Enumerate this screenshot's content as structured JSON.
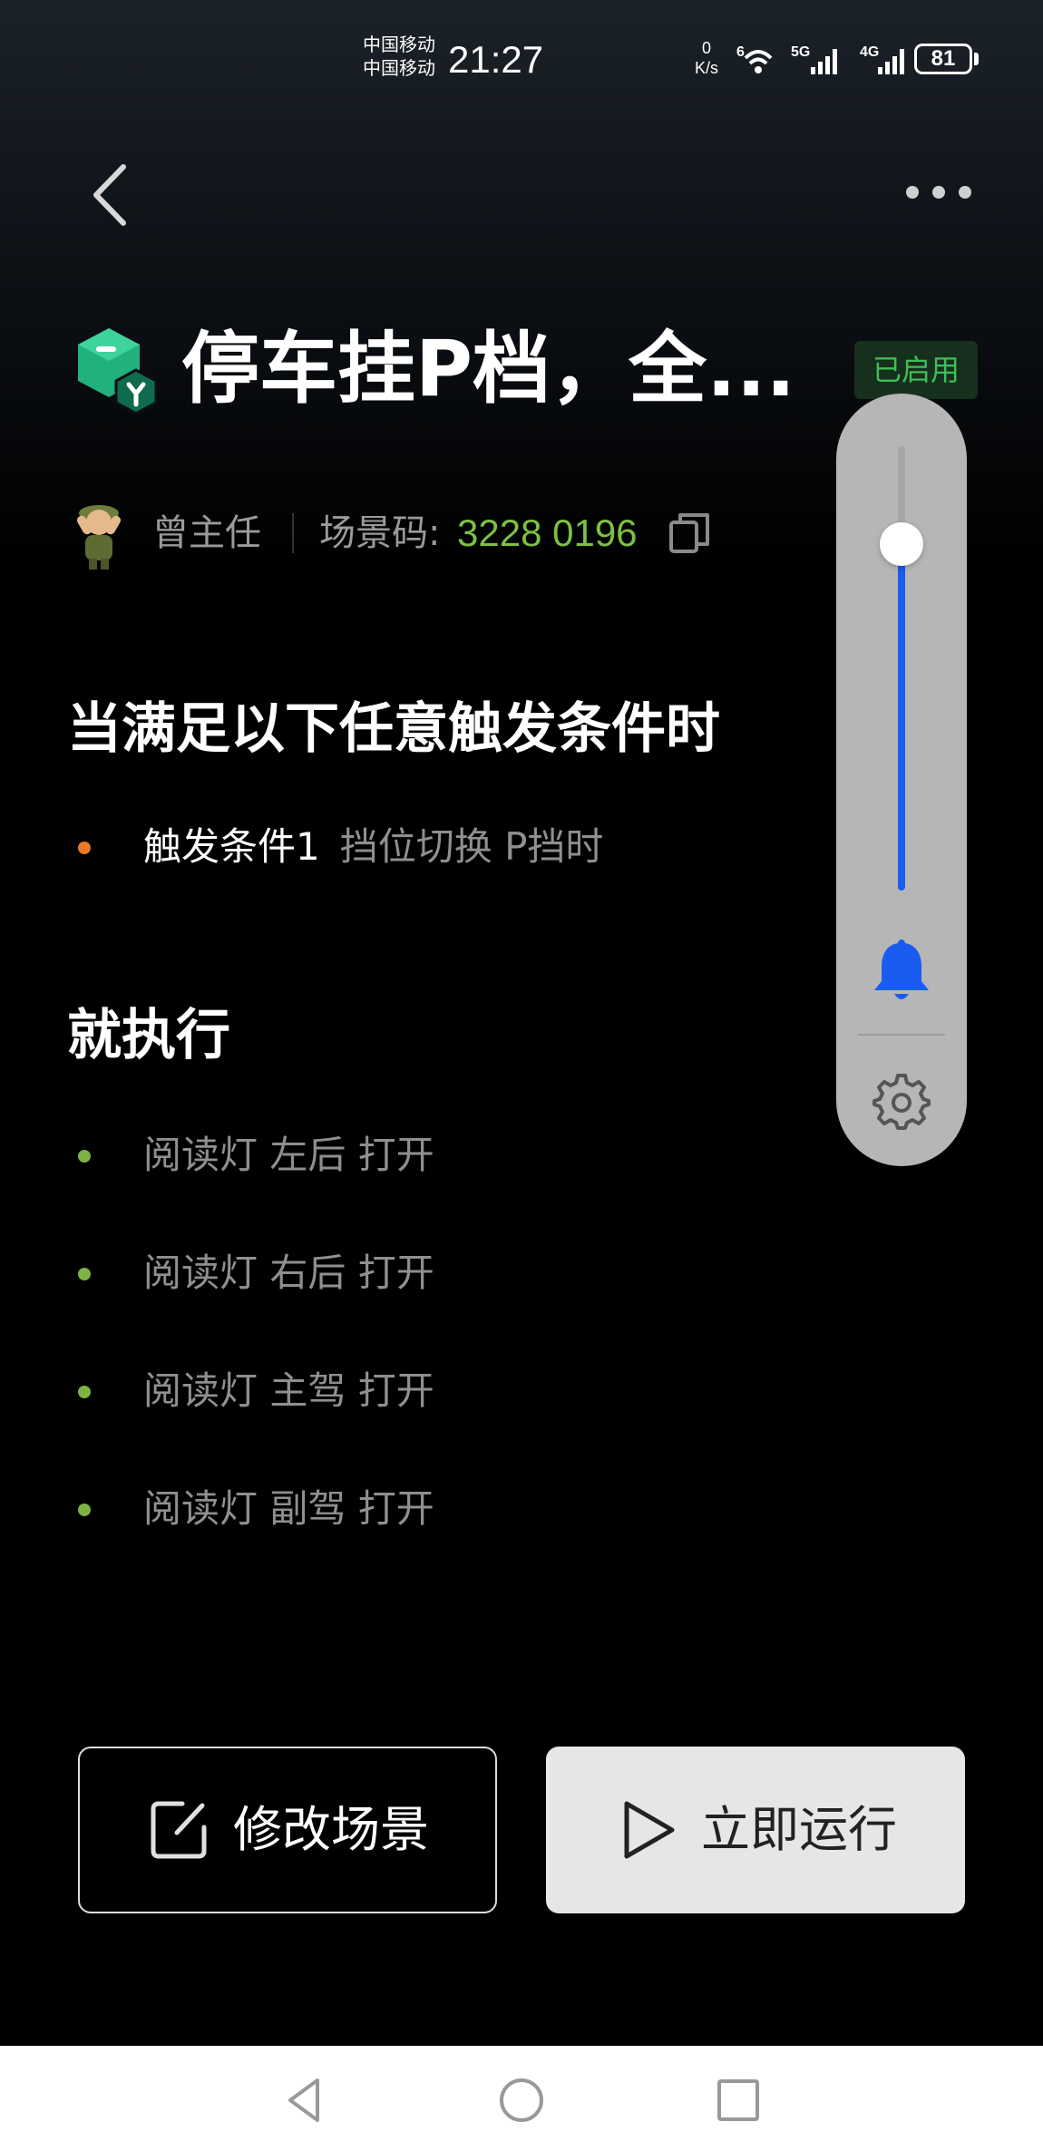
{
  "status_bar": {
    "carrier_1": "中国移动",
    "carrier_2": "中国移动",
    "time": "21:27",
    "speed_value": "0",
    "speed_unit": "K/s",
    "wifi_label": "6",
    "net_5g": "5G",
    "net_4g": "4G",
    "battery": "81"
  },
  "header": {
    "title": "停车挂P档，全...",
    "enabled_badge": "已启用"
  },
  "author": {
    "name": "曾主任",
    "scene_code_label": "场景码: ",
    "scene_code": "3228 0196"
  },
  "triggers": {
    "heading": "当满足以下任意触发条件时",
    "items": [
      {
        "label": "触发条件1",
        "detail": "挡位切换 P挡时"
      }
    ]
  },
  "actions": {
    "heading": "就执行",
    "items": [
      {
        "text": "阅读灯 左后 打开"
      },
      {
        "text": "阅读灯 右后 打开"
      },
      {
        "text": "阅读灯 主驾 打开"
      },
      {
        "text": "阅读灯 副驾 打开"
      }
    ]
  },
  "volume_panel": {
    "level_fraction": 0.78,
    "accent_color": "#1a5cf0"
  },
  "buttons": {
    "edit": "修改场景",
    "run": "立即运行"
  },
  "colors": {
    "enabled": "#3fbe58",
    "scene_code": "#7cc142",
    "trigger_bullet": "#e8782a",
    "action_bullet": "#7cb342"
  }
}
